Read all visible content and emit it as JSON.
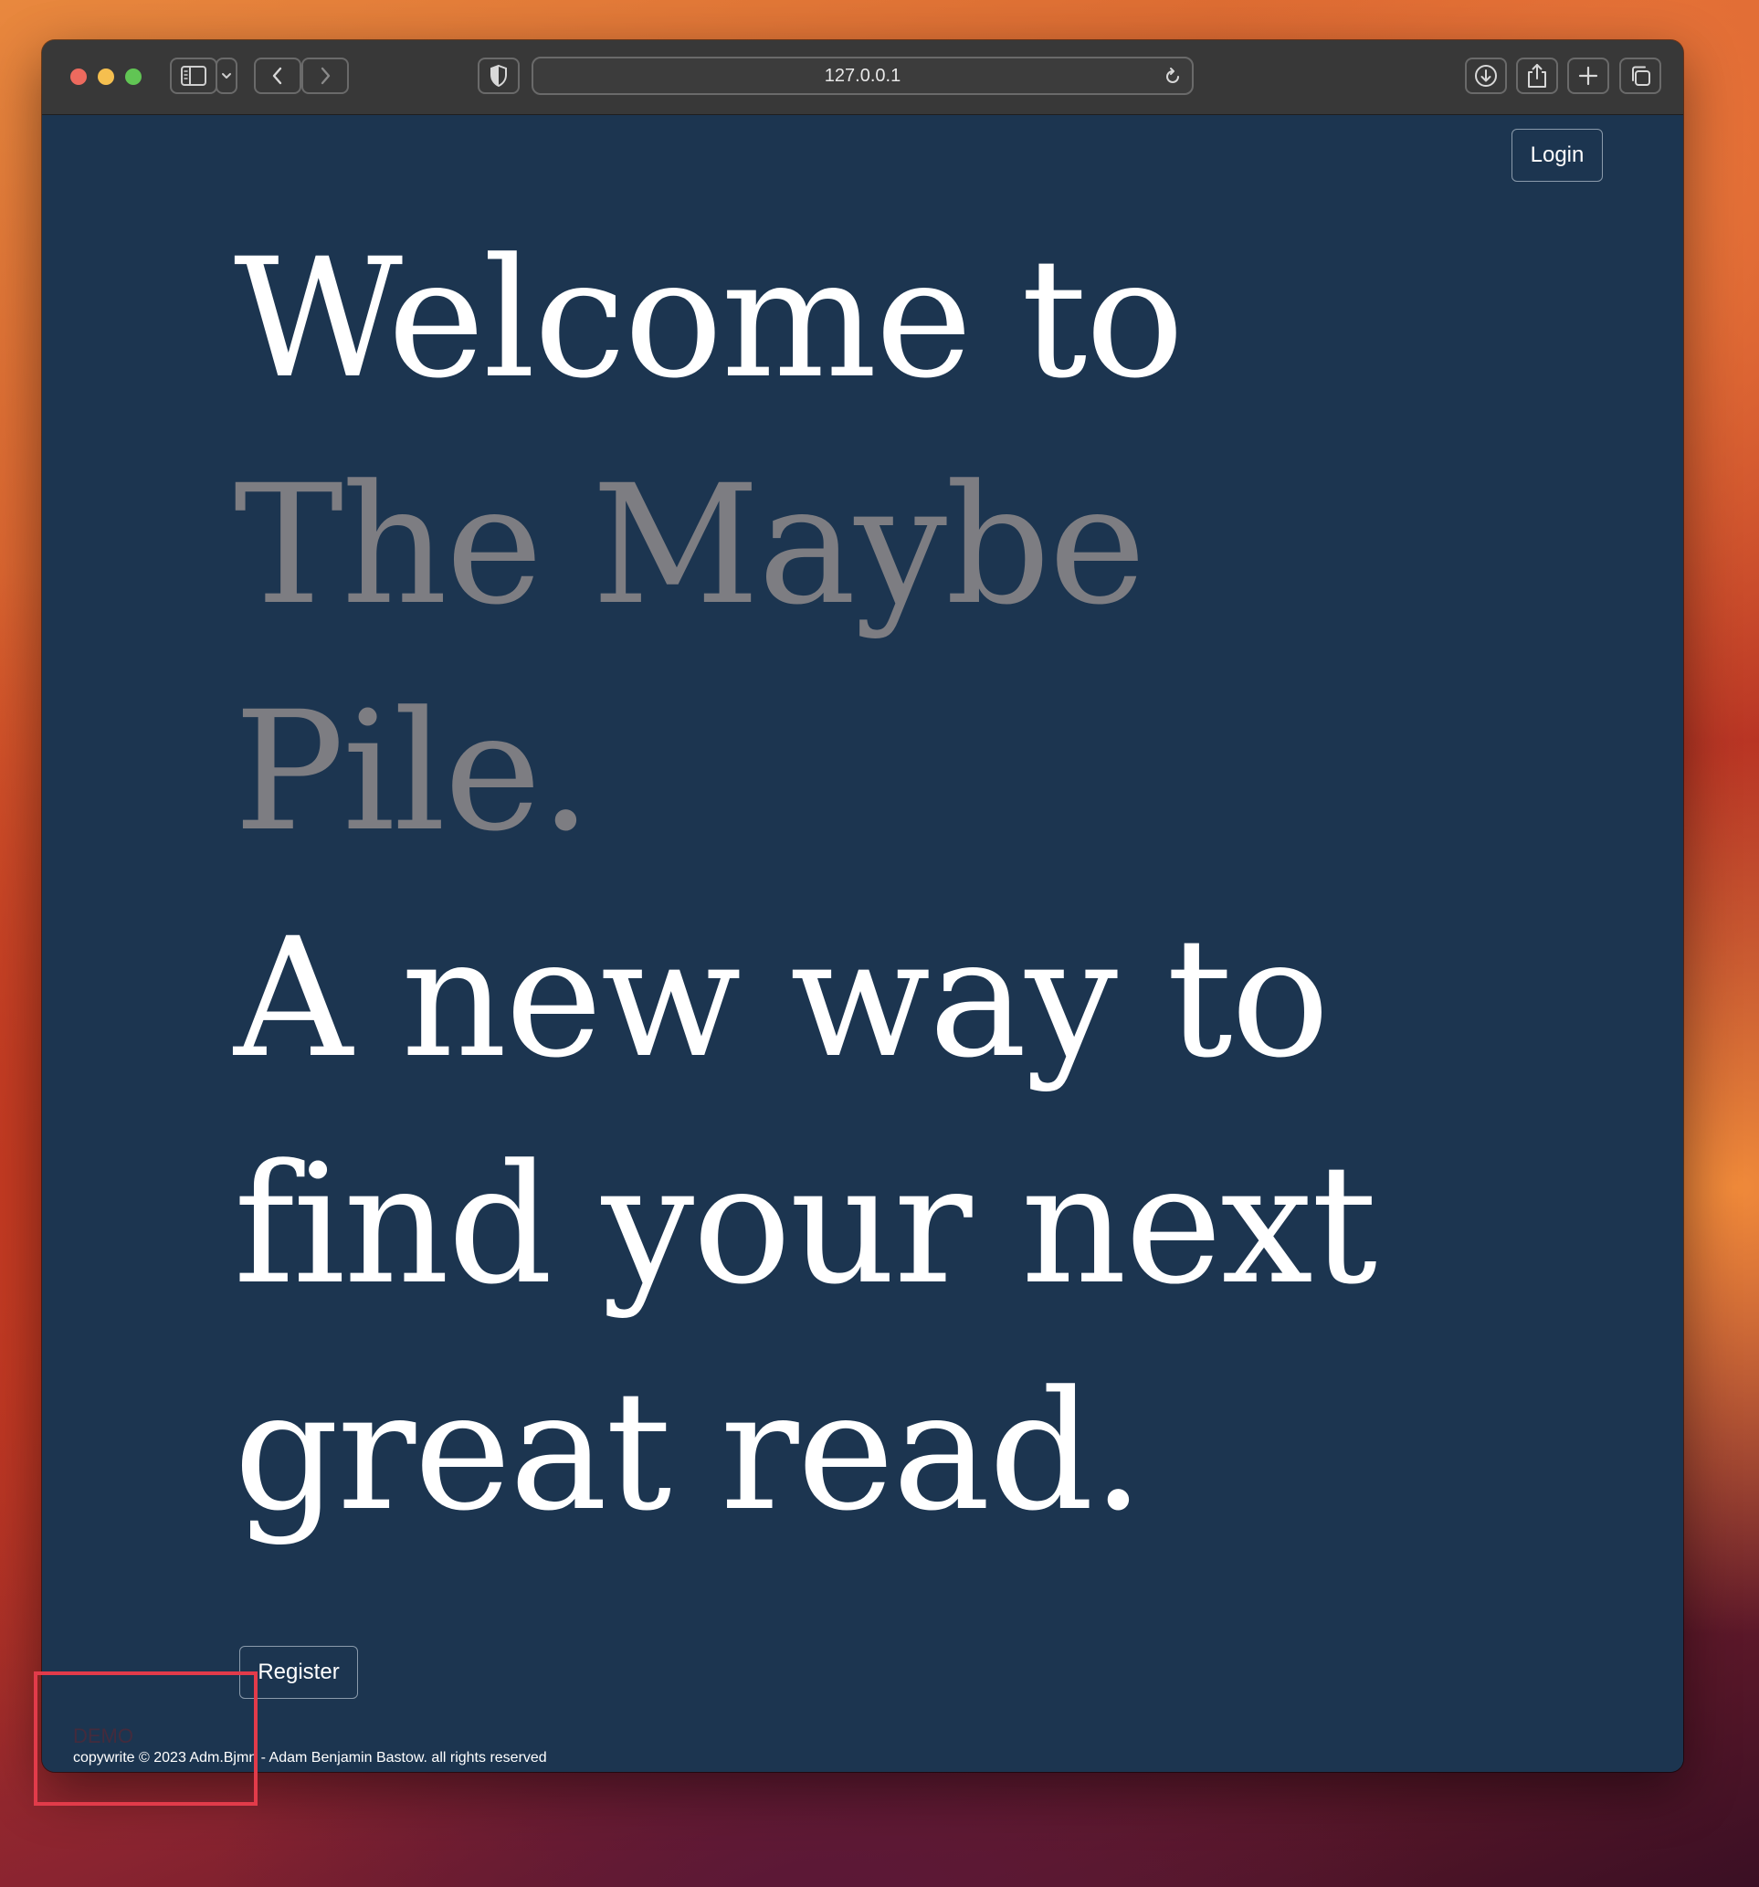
{
  "browser": {
    "url": "127.0.0.1"
  },
  "header": {
    "login_label": "Login"
  },
  "hero": {
    "line1": "Welcome to",
    "line2": "The Maybe",
    "line3": "Pile.",
    "line4": "A new way to",
    "line5": "find your next",
    "line6": "great read.",
    "highlight_color": "#7d7d82",
    "text_color": "#ffffff"
  },
  "actions": {
    "register_label": "Register"
  },
  "footer": {
    "demo_label": "DEMO",
    "copyright": "copywrite © 2023 Adm.Bjmn - Adam Benjamin Bastow. all rights reserved"
  },
  "colors": {
    "page_background": "#1c3550",
    "annotation": "#e23b4a"
  },
  "icons": {
    "sidebar": "sidebar-icon",
    "sidebar_menu": "chevron-down-icon",
    "back": "chevron-left-icon",
    "forward": "chevron-right-icon",
    "privacy": "shield-icon",
    "reload": "reload-icon",
    "downloads": "download-icon",
    "share": "share-icon",
    "new_tab": "plus-icon",
    "tab_overview": "tabs-icon"
  }
}
